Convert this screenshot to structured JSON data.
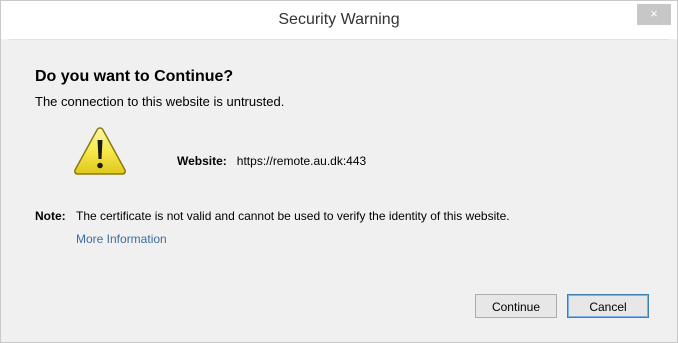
{
  "window": {
    "title": "Security Warning",
    "close_glyph": "×"
  },
  "dialog": {
    "heading": "Do you want to Continue?",
    "subheading": "The connection to this website is untrusted.",
    "icon": "warning-icon",
    "website_label": "Website:",
    "website_value": "https://remote.au.dk:443",
    "note_label": "Note:",
    "note_text": "The certificate is not valid and cannot be used to verify the identity of this website.",
    "more_info_link": "More Information"
  },
  "buttons": {
    "continue_label": "Continue",
    "cancel_label": "Cancel"
  },
  "colors": {
    "dialog_background": "#f0f0f0",
    "link": "#3f6c9f",
    "warning_yellow": "#f7e84a",
    "default_button_border": "#3c7fb1"
  }
}
